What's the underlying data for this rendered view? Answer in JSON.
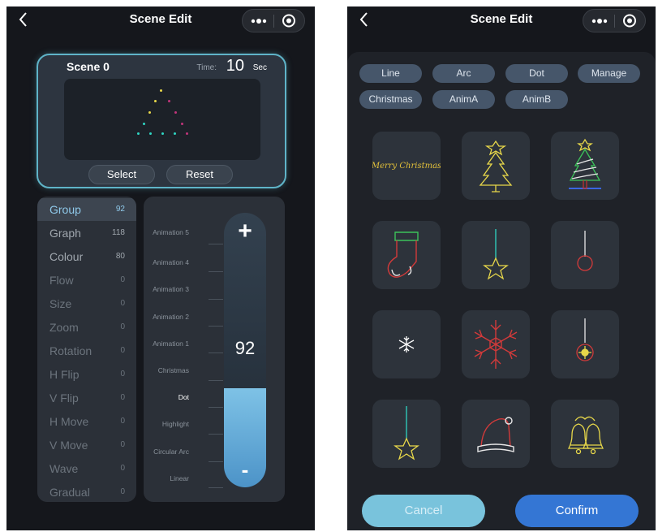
{
  "left": {
    "title": "Scene Edit",
    "preview": {
      "scene_name": "Scene 0",
      "time_label": "Time:",
      "time_value": "10",
      "time_unit": "Sec",
      "select_label": "Select",
      "reset_label": "Reset"
    },
    "menu": [
      {
        "label": "Group",
        "value": "92"
      },
      {
        "label": "Graph",
        "value": "118"
      },
      {
        "label": "Colour",
        "value": "80"
      },
      {
        "label": "Flow",
        "value": "0"
      },
      {
        "label": "Size",
        "value": "0"
      },
      {
        "label": "Zoom",
        "value": "0"
      },
      {
        "label": "Rotation",
        "value": "0"
      },
      {
        "label": "H Flip",
        "value": "0"
      },
      {
        "label": "V Flip",
        "value": "0"
      },
      {
        "label": "H Move",
        "value": "0"
      },
      {
        "label": "V Move",
        "value": "0"
      },
      {
        "label": "Wave",
        "value": "0"
      },
      {
        "label": "Gradual",
        "value": "0"
      }
    ],
    "dial": {
      "labels": [
        "Animation 5",
        "Animation 4",
        "Animation 3",
        "Animation 2",
        "Animation 1",
        "Christmas",
        "Dot",
        "Highlight",
        "Circular Arc",
        "Linear"
      ],
      "selected": "Dot",
      "plus": "+",
      "minus": "-",
      "value": "92",
      "fill_fraction": 0.36
    },
    "colors": {
      "accent": "#8fc9ea",
      "frame": "#5fb4c8"
    }
  },
  "right": {
    "title": "Scene Edit",
    "chips_row1": [
      "Line",
      "Arc",
      "Dot",
      "Manage"
    ],
    "chips_row2": [
      "Christmas",
      "AnimA",
      "AnimB"
    ],
    "tiles": [
      {
        "icon": "merry-christmas-script-icon",
        "script": "Merry Christmas"
      },
      {
        "icon": "christmas-tree-icon"
      },
      {
        "icon": "decorated-tree-icon"
      },
      {
        "icon": "stocking-icon"
      },
      {
        "icon": "hanging-star-icon"
      },
      {
        "icon": "hanging-ball-icon"
      },
      {
        "icon": "small-snowflake-icon"
      },
      {
        "icon": "snowflake-icon"
      },
      {
        "icon": "ornament-icon"
      },
      {
        "icon": "hanging-star-small-icon"
      },
      {
        "icon": "santa-hat-icon"
      },
      {
        "icon": "bells-icon"
      }
    ],
    "cancel_label": "Cancel",
    "confirm_label": "Confirm",
    "colors": {
      "confirm": "#3476d4",
      "cancel": "#79c3dc"
    }
  }
}
